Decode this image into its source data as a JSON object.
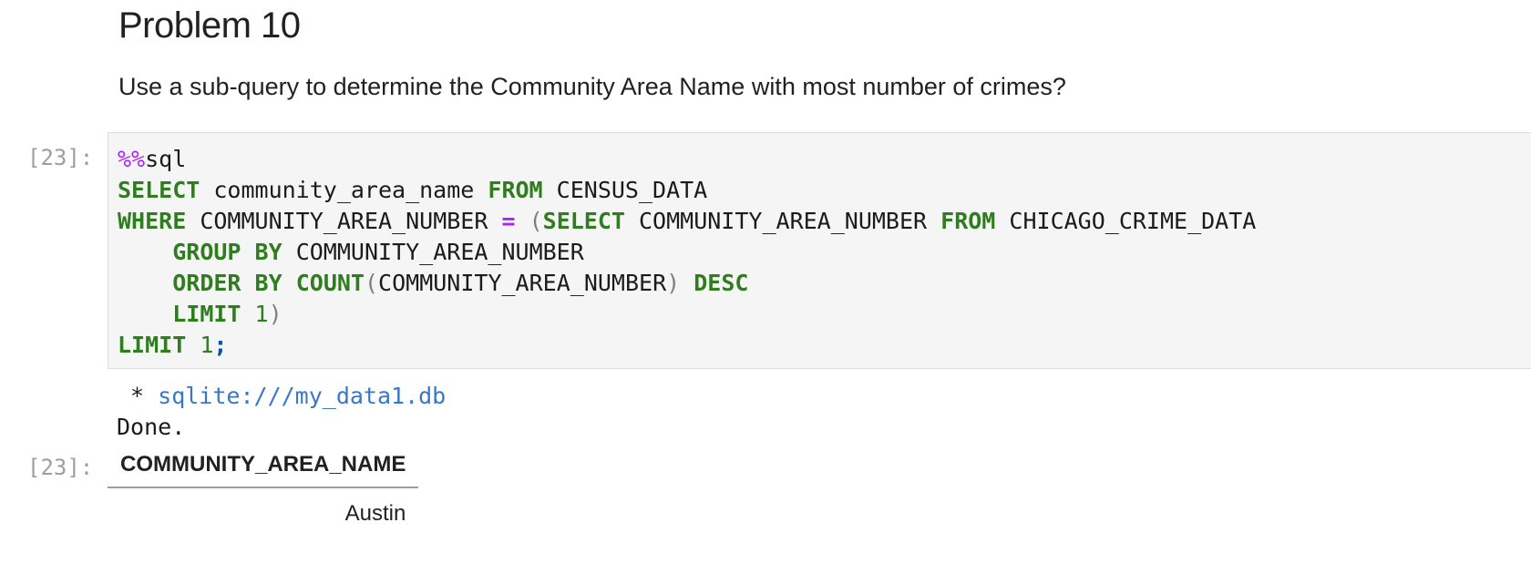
{
  "markdown": {
    "heading": "Problem 10",
    "text": "Use a sub-query to determine the Community Area Name with most number of crimes?"
  },
  "code_cell": {
    "prompt": "[23]:",
    "tokens": {
      "magic": "%%",
      "magic_name": "sql",
      "select": "SELECT",
      "col1": " community_area_name ",
      "from": "FROM",
      "table1": " CENSUS_DATA",
      "where": "WHERE",
      "col2": " COMMUNITY_AREA_NUMBER ",
      "eq": "=",
      "space": " ",
      "lparen": "(",
      "select2": "SELECT",
      "col3": " COMMUNITY_AREA_NUMBER ",
      "from2": "FROM",
      "table2": " CHICAGO_CRIME_DATA",
      "indent": "    ",
      "group": "GROUP",
      "by": "BY",
      "col4": " COMMUNITY_AREA_NUMBER",
      "order": "ORDER",
      "by2": "BY",
      "count": "COUNT",
      "lparen2": "(",
      "col5": "COMMUNITY_AREA_NUMBER",
      "rparen2": ")",
      "desc": "DESC",
      "limit_inner": "LIMIT",
      "one_inner": "1",
      "rparen": ")",
      "limit_outer": "LIMIT",
      "one_outer": "1",
      "semicolon": ";"
    }
  },
  "output": {
    "stream_prefix": " * ",
    "connection": "sqlite:///my_data1.db",
    "done": "Done.",
    "prompt": "[23]:",
    "table": {
      "columns": [
        "COMMUNITY_AREA_NAME"
      ],
      "rows": [
        [
          "Austin"
        ]
      ]
    }
  }
}
